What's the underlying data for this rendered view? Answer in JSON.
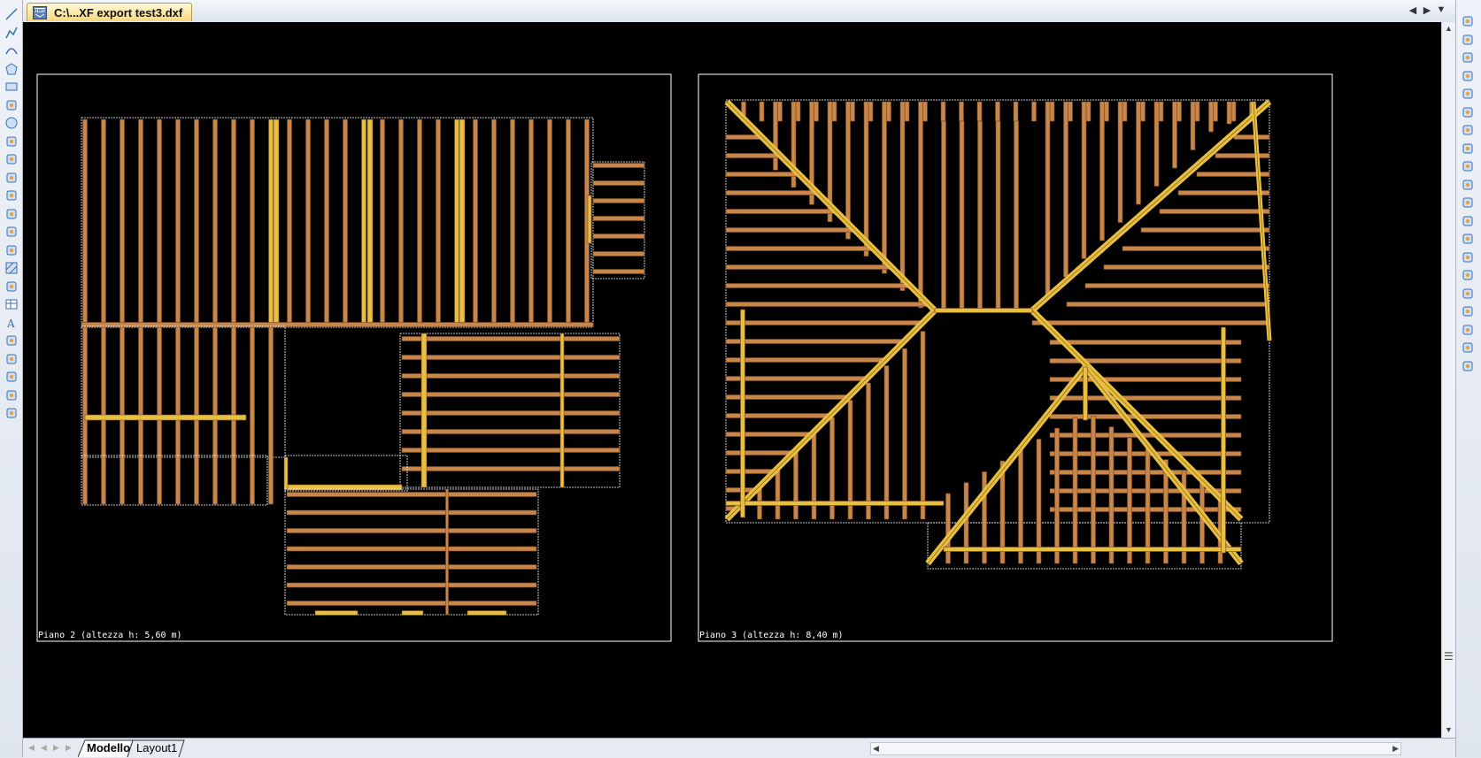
{
  "document": {
    "tab_title": "C:\\...XF export test3.dxf",
    "file_icon_label": "DWG"
  },
  "tab_nav": {
    "prev": "◀",
    "next": "▶",
    "menu": "▼"
  },
  "viewports": [
    {
      "label": "Piano 2 (altezza h: 5,60 m)"
    },
    {
      "label": "Piano 3 (altezza h: 8,40 m)"
    }
  ],
  "layout_tabs": {
    "model": "Modello",
    "layout1": "Layout1"
  },
  "colors": {
    "background": "#000000",
    "timber": "#c8864a",
    "timber_edge": "#7a4a20",
    "highlight_timber": "#e8c040",
    "wall": "#ffffff"
  },
  "left_tools": [
    "line-icon",
    "polyline-icon",
    "arc-icon",
    "polygon-icon",
    "rectangle-icon",
    "spline-icon",
    "circle-icon",
    "revision-cloud-icon",
    "freehand-icon",
    "ellipse-icon",
    "ellipse-arc-icon",
    "insert-block-icon",
    "make-block-icon",
    "point-icon",
    "hatch-icon",
    "region-icon",
    "table-icon",
    "text-icon",
    "dimension-icon",
    "tolerance-icon",
    "mtext-icon",
    "properties-icon",
    "ucs-icon"
  ],
  "right_tools": [
    "erase-icon",
    "copy-icon",
    "mirror-icon",
    "offset-icon",
    "array-icon",
    "move-icon",
    "rotate-icon",
    "scale-icon",
    "stretch-icon",
    "trim-icon",
    "extend-icon",
    "break-icon",
    "join-icon",
    "chamfer-icon",
    "fillet-icon",
    "explode-icon",
    "layer-icon",
    "layer-states-icon",
    "layer-previous-icon",
    "layer-isolate-icon"
  ]
}
